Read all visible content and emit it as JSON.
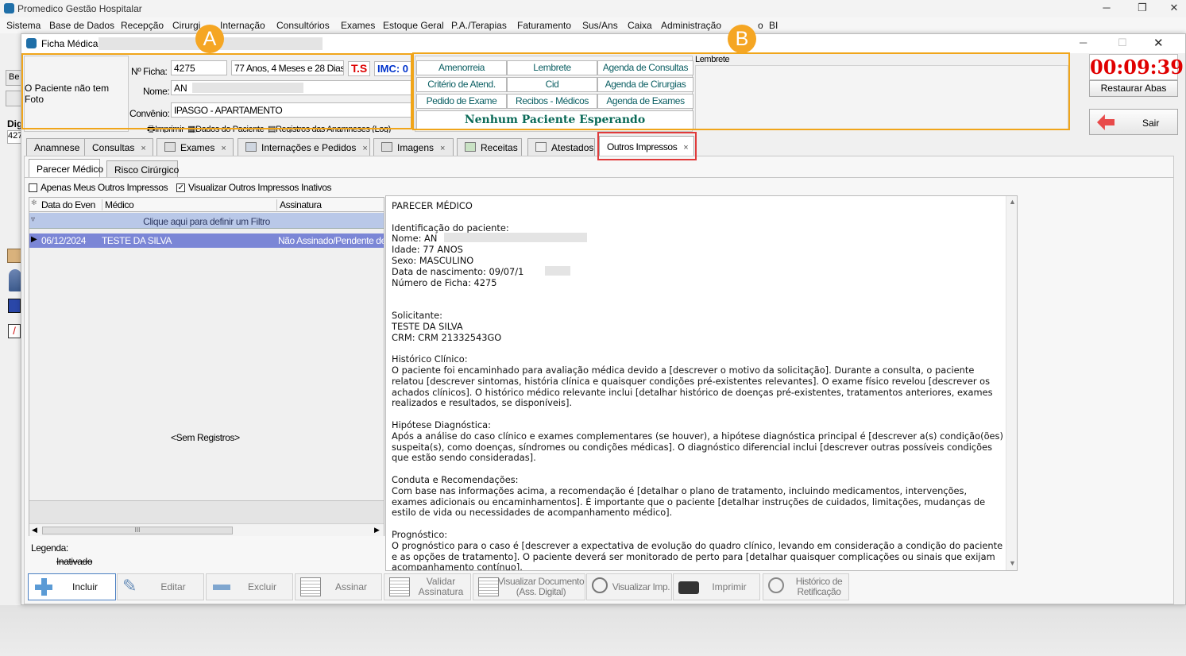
{
  "app": {
    "title": "Promedico Gestão Hospitalar",
    "menu": [
      "Sistema",
      "Base de Dados",
      "Recepção",
      "Cirurgias",
      "Internação",
      "Consultórios",
      "Exames",
      "Estoque Geral",
      "P.A./Terapias",
      "Faturamento",
      "Sus/Ans",
      "Caixa",
      "Administração",
      "BI"
    ],
    "menu_partial": "Cirurgi",
    "menu_partial2": "o",
    "bg_tab1": "Be",
    "bg_label": "Dig",
    "bg_value": "427"
  },
  "window": {
    "title": "Ficha Médica"
  },
  "patient": {
    "no_photo": "O Paciente não tem Foto",
    "ficha_label": "Nº Ficha:",
    "ficha": "4275",
    "age": "77 Anos, 4 Meses e 28 Dias",
    "ts": "T.S",
    "imc": "IMC: 0",
    "name_label": "Nome:",
    "name": "AN",
    "convenio_label": "Convênio:",
    "convenio": "IPASGO - APARTAMENTO",
    "actions": [
      "Imprimir",
      "Dados do Paciente",
      "Registros das Anamneses (Log)"
    ]
  },
  "quick_buttons": [
    [
      "Amenorreia",
      "Lembrete",
      "Agenda de Consultas"
    ],
    [
      "Critério de Atend.",
      "Cid",
      "Agenda de Cirurgias"
    ],
    [
      "Pedido de Exame",
      "Recibos - Médicos",
      "Agenda de Exames"
    ]
  ],
  "waiting": "Nenhum Paciente Esperando",
  "lembrete_label": "Lembrete",
  "timer": "00:09:39",
  "restore_tabs": "Restaurar Abas",
  "exit": "Sair",
  "callouts": {
    "a": "A",
    "b": "B"
  },
  "tabs": [
    {
      "label": "Anamnese",
      "close": ""
    },
    {
      "label": "Consultas",
      "close": "×"
    },
    {
      "label": "Exames",
      "close": "×"
    },
    {
      "label": "Internações e Pedidos",
      "close": "×"
    },
    {
      "label": "Imagens",
      "close": "×"
    },
    {
      "label": "Receitas",
      "close": ""
    },
    {
      "label": "Atestados",
      "close": ""
    },
    {
      "label": "Outros Impressos",
      "close": "×"
    }
  ],
  "subtabs": [
    "Parecer Médico",
    "Risco Cirúrgico"
  ],
  "filters": {
    "only_mine": "Apenas Meus Outros Impressos",
    "show_inactive": "Visualizar Outros Impressos Inativos",
    "show_inactive_checked": true
  },
  "grid": {
    "columns": [
      "Data do Even",
      "Médico",
      "Assinatura"
    ],
    "filter_hint": "Clique aqui para definir um Filtro",
    "rows": [
      {
        "date": "06/12/2024",
        "doctor": "TESTE DA SILVA",
        "status": "Não Assinado/Pendente de"
      }
    ],
    "empty": "<Sem Registros>",
    "scroll_thumb": "III"
  },
  "legend": {
    "label": "Legenda:",
    "inactive": "Inativado"
  },
  "document": {
    "text": "PARECER MÉDICO\n\nIdentificação do paciente:\nNome: AN\nIdade: 77 ANOS\nSexo: MASCULINO\nData de nascimento: 09/07/1\nNúmero de Ficha: 4275\n\n\nSolicitante:\nTESTE DA SILVA\nCRM: CRM 21332543GO\n\nHistórico Clínico:\nO paciente foi encaminhado para avaliação médica devido a [descrever o motivo da solicitação]. Durante a consulta, o paciente relatou [descrever sintomas, história clínica e quaisquer condições pré-existentes relevantes]. O exame físico revelou [descrever os achados clínicos]. O histórico médico relevante inclui [detalhar histórico de doenças pré-existentes, tratamentos anteriores, exames realizados e resultados, se disponíveis].\n\nHipótese Diagnóstica:\nApós a análise do caso clínico e exames complementares (se houver), a hipótese diagnóstica principal é [descrever a(s) condição(ões) suspeita(s), como doenças, síndromes ou condições médicas]. O diagnóstico diferencial inclui [descrever outras possíveis condições que estão sendo consideradas].\n\nConduta e Recomendações:\nCom base nas informações acima, a recomendação é [detalhar o plano de tratamento, incluindo medicamentos, intervenções, exames adicionais ou encaminhamentos]. É importante que o paciente [detalhar instruções de cuidados, limitações, mudanças de estilo de vida ou necessidades de acompanhamento médico].\n\nPrognóstico:\nO prognóstico para o caso é [descrever a expectativa de evolução do quadro clínico, levando em consideração a condição do paciente e as opções de tratamento]. O paciente deverá ser monitorado de perto para [detalhar quaisquer complicações ou sinais que exijam acompanhamento contínuo]."
  },
  "toolbar": {
    "include": "Incluir",
    "edit": "Editar",
    "delete": "Excluir",
    "sign": "Assinar",
    "validate": "Validar Assinatura",
    "view_doc": "Visualizar Documento (Ass. Digital)",
    "view_imp": "Visualizar Imp.",
    "print": "Imprimir",
    "history": "Histórico de Retificação"
  },
  "colors": {
    "accent_orange": "#f5a623",
    "highlight_red": "#e03a3a",
    "timer_red": "#e00000",
    "teal": "#0a5e62",
    "row_select": "#7b86d6"
  }
}
